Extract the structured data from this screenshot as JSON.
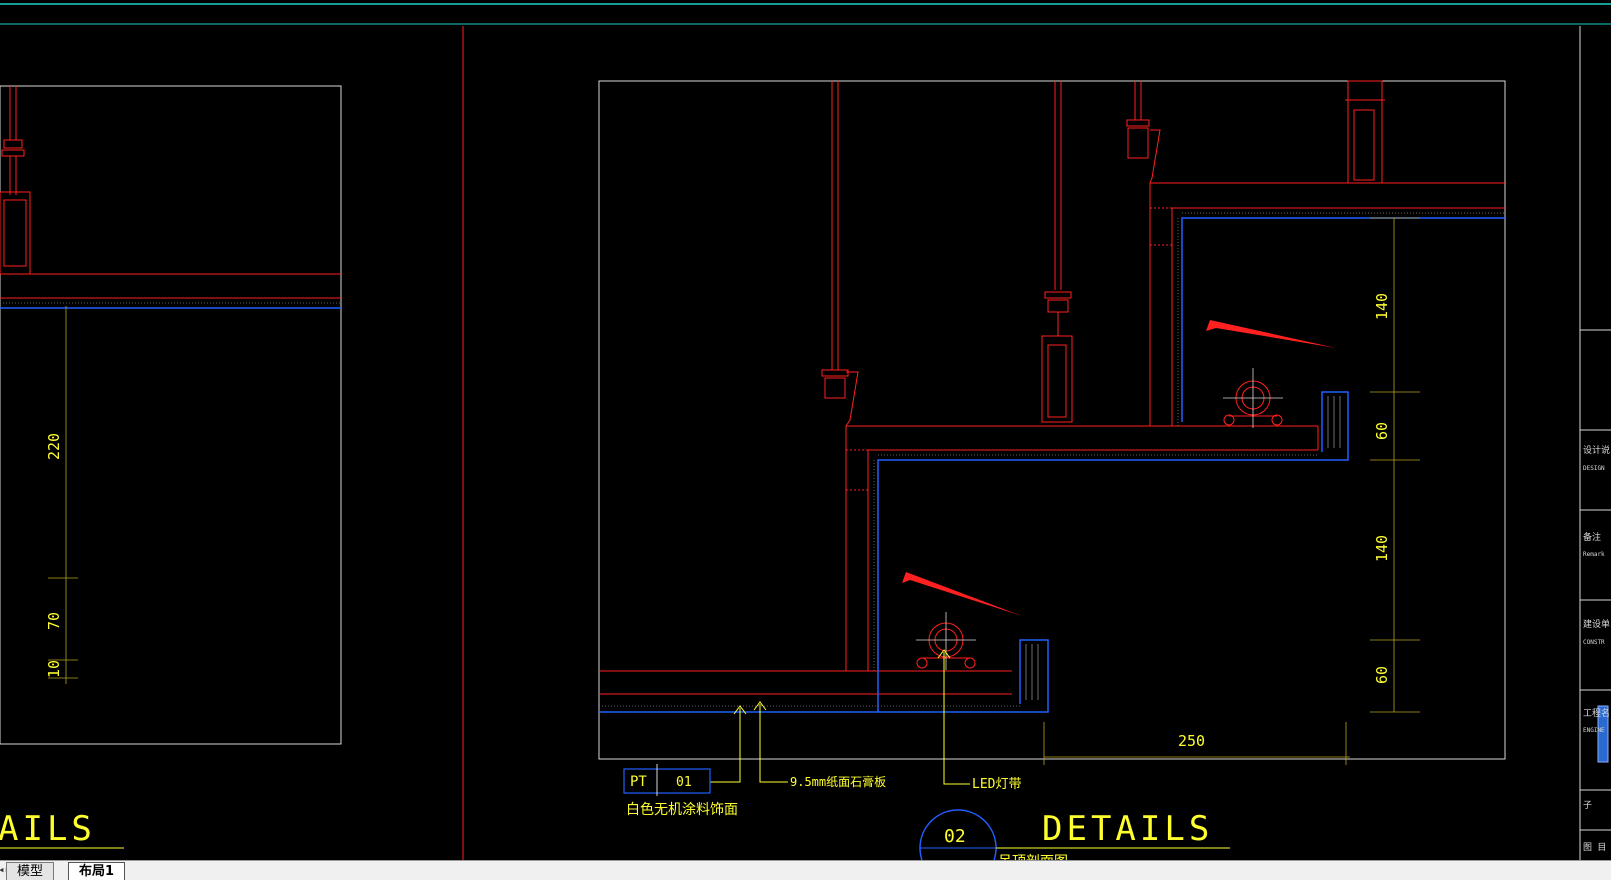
{
  "tabs": {
    "model": "模型",
    "layout1": "布局1"
  },
  "left_detail": {
    "dimensions": [
      "220",
      "70",
      "10"
    ],
    "title_fragment": "AILS"
  },
  "right_detail": {
    "dimensions_vertical": [
      "140",
      "60",
      "140",
      "60"
    ],
    "dimension_horizontal": "250",
    "material_tag": {
      "code": "PT",
      "number": "01",
      "description": "白色无机涂料饰面"
    },
    "callouts": {
      "gypsum_board": "9.5mm纸面石膏板",
      "led": "LED灯带"
    },
    "detail_number": "02",
    "title": "DETAILS",
    "subtitle_fragment": "吊顶剖面图"
  },
  "title_block": {
    "labels": [
      "设计说",
      "DESIGN",
      "备注",
      "Remark",
      "建设单",
      "CONSTR",
      "工程名",
      "ENGINE",
      "子",
      "图 目"
    ]
  },
  "colors": {
    "red": "#ff2020",
    "blue": "#2060ff",
    "yellow": "#ffff30",
    "cyan": "#1ad0c8",
    "frame": "#d8d8d8",
    "white": "#ffffff"
  }
}
